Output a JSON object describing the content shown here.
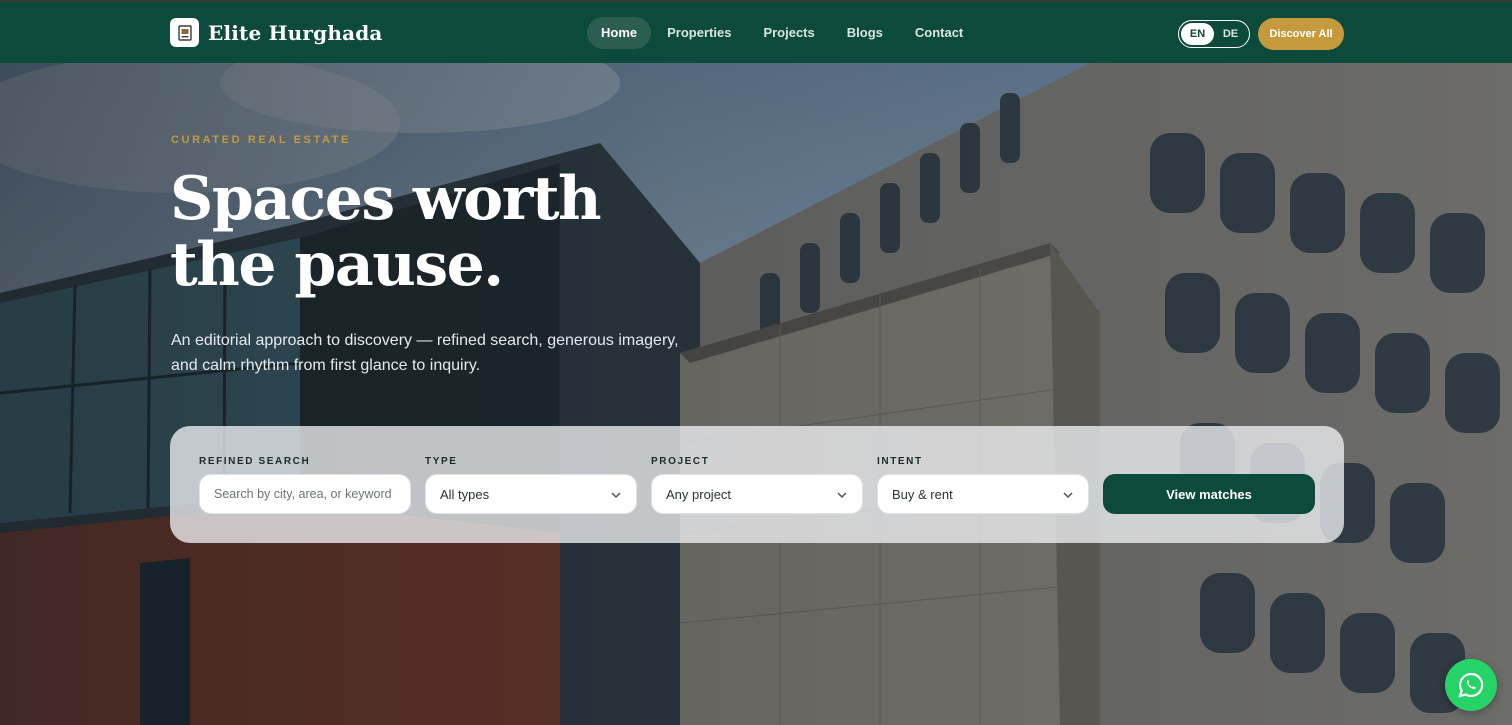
{
  "header": {
    "brand_name": "Elite Hurghada",
    "nav": [
      {
        "label": "Home",
        "active": true
      },
      {
        "label": "Properties",
        "active": false
      },
      {
        "label": "Projects",
        "active": false
      },
      {
        "label": "Blogs",
        "active": false
      },
      {
        "label": "Contact",
        "active": false
      }
    ],
    "languages": [
      {
        "label": "EN",
        "active": true
      },
      {
        "label": "DE",
        "active": false
      }
    ],
    "cta_label": "Discover All"
  },
  "hero": {
    "eyebrow": "CURATED REAL ESTATE",
    "headline_line1": "Spaces worth",
    "headline_line2": "the pause.",
    "subline": "An editorial approach to discovery — refined search, generous imagery, and calm rhythm from first glance to inquiry."
  },
  "search": {
    "refined": {
      "label": "REFINED SEARCH",
      "placeholder": "Search by city, area, or keyword",
      "value": ""
    },
    "type": {
      "label": "TYPE",
      "value": "All types"
    },
    "project": {
      "label": "PROJECT",
      "value": "Any project"
    },
    "intent": {
      "label": "INTENT",
      "value": "Buy & rent"
    },
    "submit_label": "View matches"
  },
  "colors": {
    "brand_green": "#0c4a3b",
    "accent_gold": "#c49a3c",
    "whatsapp_green": "#25d366"
  },
  "icons": {
    "chevron": "chevron-down-icon",
    "whatsapp": "whatsapp-icon",
    "logo": "brand-logo-icon"
  }
}
